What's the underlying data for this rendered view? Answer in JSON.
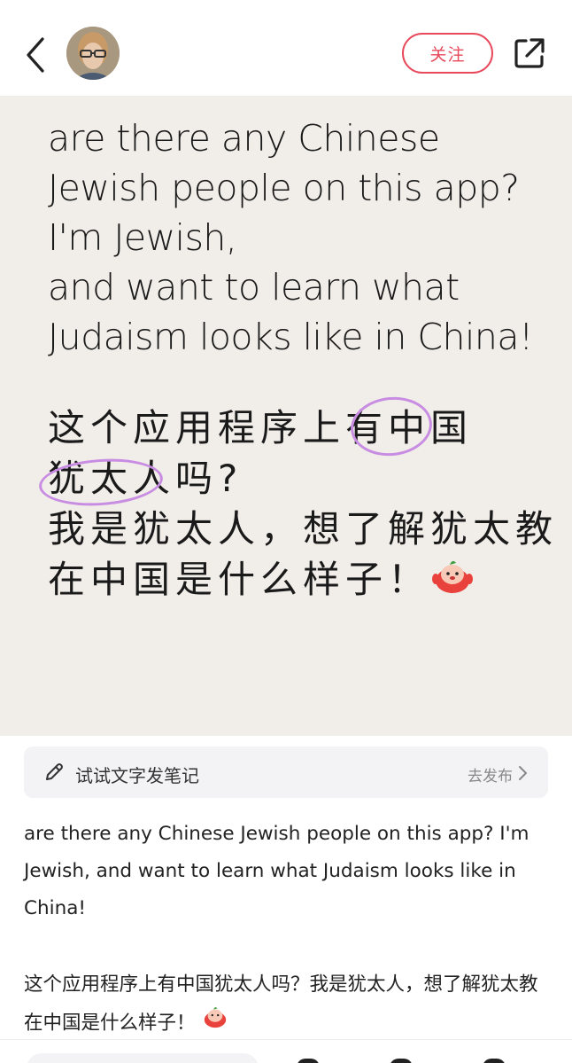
{
  "header": {
    "back_icon": "chevron-left-icon",
    "avatar_icon": "user-avatar",
    "follow_label": "关注",
    "share_icon": "share-out-icon",
    "accent_color": "#e8495b"
  },
  "card": {
    "en_lines": [
      "are there any Chinese",
      "Jewish people on this app?",
      "I'm Jewish,",
      "and want to learn what",
      "Judaism looks like in China!"
    ],
    "zh_line1_a": "这个应用程序上有",
    "zh_line1_b": "中国",
    "zh_line2_a": "犹太人",
    "zh_line2_b": "吗?",
    "zh_line3": "我是犹太人，想了解犹太教",
    "zh_line4": "在中国是什么样子！",
    "emoji_icon": "red-mascot-emoji-icon",
    "background_color": "#f1eee9",
    "highlight_color": "#c88de2"
  },
  "prompt": {
    "pencil_icon": "pencil-icon",
    "label": "试试文字发笔记",
    "action": "去发布"
  },
  "description": {
    "en": "are there any Chinese Jewish people on this app? I'm Jewish, and want to learn what Judaism looks like in China!",
    "zh": "这个应用程序上有中国犹太人吗？我是犹太人，想了解犹太教在中国是什么样子！"
  }
}
